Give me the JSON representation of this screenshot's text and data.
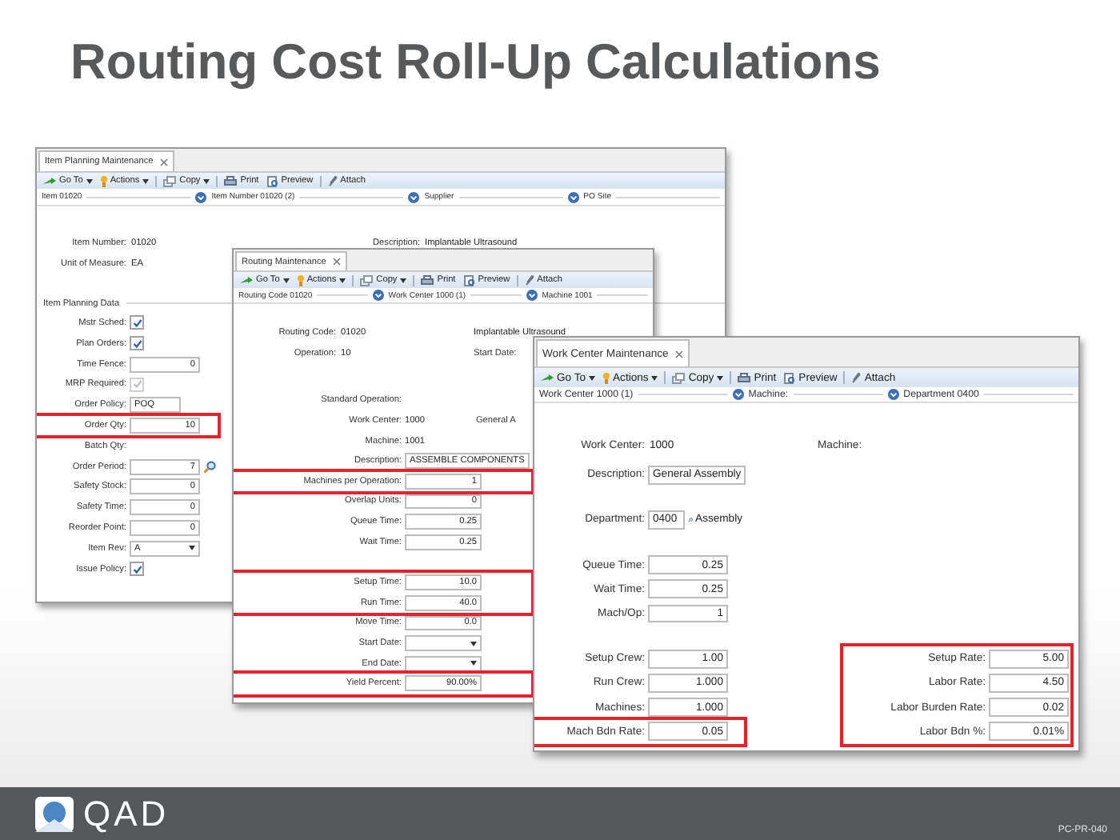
{
  "slide_title": "Routing Cost Roll-Up Calculations",
  "windows": [
    {
      "title": "Item Planning Maintenance",
      "toolbar": [
        {
          "label": "Go To",
          "dropdown": true
        },
        {
          "label": "Actions",
          "dropdown": true
        },
        {
          "label": "Copy",
          "dropdown": true
        },
        {
          "label": "Print",
          "dropdown": false
        },
        {
          "label": "Preview",
          "dropdown": false
        },
        {
          "label": "Attach",
          "dropdown": false
        }
      ],
      "header": [
        "Item 01020",
        "Item Number 01020 (2)",
        "Supplier",
        "PO Site"
      ],
      "info_rows": [
        [
          {
            "label": "Item Number:",
            "value": "01020"
          },
          {
            "label": "Description:",
            "value": "Implantable Ultrasound"
          }
        ],
        [
          {
            "label": "Unit of Measure:",
            "value": "EA"
          }
        ]
      ],
      "section_title": "Item Planning Data",
      "columns": [
        {
          "sections": [
            {
              "groups": [
                {
                  "highlighted": false,
                  "rows": [
                    {
                      "kind": "checkbox",
                      "label": "Mstr Sched:",
                      "checked": true,
                      "disabled": false
                    },
                    {
                      "kind": "checkbox",
                      "label": "Plan Orders:",
                      "checked": true,
                      "disabled": false
                    },
                    {
                      "kind": "number",
                      "label": "Time Fence:",
                      "value": "0"
                    },
                    {
                      "kind": "checkbox",
                      "label": "MRP Required:",
                      "checked": true,
                      "disabled": true
                    },
                    {
                      "kind": "text_field",
                      "label": "Order Policy:",
                      "value": "POQ"
                    }
                  ]
                },
                {
                  "highlighted": true,
                  "rows": [
                    {
                      "kind": "number",
                      "label": "Order Qty:",
                      "value": "10"
                    }
                  ]
                },
                {
                  "highlighted": false,
                  "rows": [
                    {
                      "kind": "label_only",
                      "label": "Batch Qty:"
                    },
                    {
                      "kind": "lookup",
                      "label": "Order Period:",
                      "value": "7"
                    },
                    {
                      "kind": "number",
                      "label": "Safety Stock:",
                      "value": "0"
                    },
                    {
                      "kind": "number",
                      "label": "Safety Time:",
                      "value": "0"
                    },
                    {
                      "kind": "number",
                      "label": "Reorder Point:",
                      "value": "0"
                    },
                    {
                      "kind": "select",
                      "label": "Item Rev:",
                      "value": "A"
                    },
                    {
                      "kind": "checkbox",
                      "label": "Issue Policy:",
                      "checked": true,
                      "disabled": false
                    }
                  ]
                }
              ]
            }
          ]
        }
      ]
    },
    {
      "title": "Routing Maintenance",
      "toolbar": [
        {
          "label": "Go To",
          "dropdown": true
        },
        {
          "label": "Actions",
          "dropdown": true
        },
        {
          "label": "Copy",
          "dropdown": true
        },
        {
          "label": "Print",
          "dropdown": false
        },
        {
          "label": "Preview",
          "dropdown": false
        },
        {
          "label": "Attach",
          "dropdown": false
        }
      ],
      "header": [
        "Routing Code 01020",
        "Work Center 1000 (1)",
        "Machine 1001"
      ],
      "info_rows": [
        [
          {
            "label": "Routing Code:",
            "value": "01020"
          },
          {
            "value": "Implantable Ultrasound"
          }
        ],
        [
          {
            "label": "Operation:",
            "value": "10"
          },
          {
            "label": "Start Date:"
          }
        ]
      ],
      "columns": [
        {
          "sections": [
            {
              "groups": [
                {
                  "highlighted": false,
                  "rows": [
                    {
                      "kind": "label_only",
                      "label": "Standard Operation:"
                    },
                    {
                      "kind": "display",
                      "label": "Work Center:",
                      "value": "1000",
                      "extra": "General A"
                    },
                    {
                      "kind": "display",
                      "label": "Machine:",
                      "value": "1001"
                    },
                    {
                      "kind": "text_field",
                      "label": "Description:",
                      "value": "ASSEMBLE COMPONENTS"
                    }
                  ]
                },
                {
                  "highlighted": true,
                  "rows": [
                    {
                      "kind": "number",
                      "label": "Machines per Operation:",
                      "value": "1"
                    }
                  ]
                },
                {
                  "highlighted": false,
                  "rows": [
                    {
                      "kind": "number",
                      "label": "Overlap Units:",
                      "value": "0"
                    },
                    {
                      "kind": "number",
                      "label": "Queue Time:",
                      "value": "0.25"
                    },
                    {
                      "kind": "number",
                      "label": "Wait Time:",
                      "value": "0.25"
                    }
                  ]
                }
              ]
            },
            {
              "groups": [
                {
                  "highlighted": true,
                  "rows": [
                    {
                      "kind": "number",
                      "label": "Setup Time:",
                      "value": "10.0"
                    },
                    {
                      "kind": "number",
                      "label": "Run Time:",
                      "value": "40.0"
                    }
                  ]
                },
                {
                  "highlighted": false,
                  "rows": [
                    {
                      "kind": "number",
                      "label": "Move Time:",
                      "value": "0.0"
                    },
                    {
                      "kind": "select",
                      "label": "Start Date:"
                    },
                    {
                      "kind": "select",
                      "label": "End Date:"
                    }
                  ]
                },
                {
                  "highlighted": true,
                  "rows": [
                    {
                      "kind": "number",
                      "label": "Yield Percent:",
                      "value": "90.00%"
                    }
                  ]
                }
              ]
            }
          ]
        }
      ]
    },
    {
      "title": "Work Center Maintenance",
      "toolbar": [
        {
          "label": "Go To",
          "dropdown": true
        },
        {
          "label": "Actions",
          "dropdown": true
        },
        {
          "label": "Copy",
          "dropdown": true
        },
        {
          "label": "Print",
          "dropdown": false
        },
        {
          "label": "Preview",
          "dropdown": false
        },
        {
          "label": "Attach",
          "dropdown": false
        }
      ],
      "header": [
        "Work Center 1000 (1)",
        "Machine:",
        "Department 0400"
      ],
      "info_rows": [
        [
          {
            "label": "Work Center:",
            "value": "1000"
          },
          {
            "label": "Machine:"
          }
        ]
      ],
      "columns": [
        {
          "sections": [
            {
              "groups": [
                {
                  "highlighted": false,
                  "rows": [
                    {
                      "kind": "text_field",
                      "label": "Description:",
                      "value": "General Assembly"
                    }
                  ]
                }
              ]
            },
            {
              "groups": [
                {
                  "highlighted": false,
                  "rows": [
                    {
                      "kind": "lookup",
                      "label": "Department:",
                      "value": "0400",
                      "suffix": "Assembly"
                    }
                  ]
                }
              ]
            },
            {
              "groups": [
                {
                  "highlighted": false,
                  "rows": [
                    {
                      "kind": "number",
                      "label": "Queue Time:",
                      "value": "0.25"
                    },
                    {
                      "kind": "number",
                      "label": "Wait Time:",
                      "value": "0.25"
                    },
                    {
                      "kind": "number",
                      "label": "Mach/Op:",
                      "value": "1"
                    }
                  ]
                }
              ]
            },
            {
              "groups": [
                {
                  "highlighted": false,
                  "rows": [
                    {
                      "kind": "number",
                      "label": "Setup Crew:",
                      "value": "1.00"
                    },
                    {
                      "kind": "number",
                      "label": "Run Crew:",
                      "value": "1.000"
                    },
                    {
                      "kind": "number",
                      "label": "Machines:",
                      "value": "1.000"
                    }
                  ]
                },
                {
                  "highlighted": true,
                  "rows": [
                    {
                      "kind": "number",
                      "label": "Mach Bdn Rate:",
                      "value": "0.05"
                    }
                  ]
                }
              ]
            }
          ]
        },
        {
          "sections": [
            {
              "groups": [
                {
                  "highlighted": true,
                  "rows": [
                    {
                      "kind": "number",
                      "label": "Setup Rate:",
                      "value": "5.00"
                    },
                    {
                      "kind": "number",
                      "label": "Labor Rate:",
                      "value": "4.50"
                    },
                    {
                      "kind": "number",
                      "label": "Labor Burden Rate:",
                      "value": "0.02"
                    },
                    {
                      "kind": "number",
                      "label": "Labor Bdn %:",
                      "value": "0.01%"
                    }
                  ]
                }
              ]
            }
          ]
        }
      ]
    }
  ],
  "footer": {
    "logo_text": "QAD",
    "code": "PC-PR-040"
  }
}
